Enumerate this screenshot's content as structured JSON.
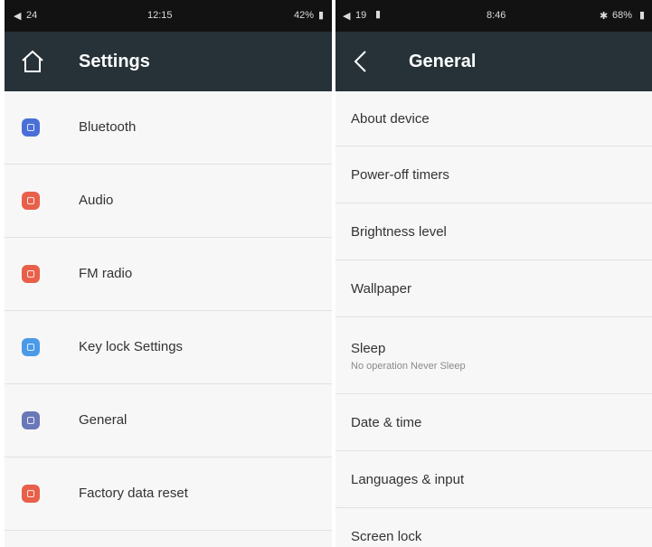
{
  "left": {
    "status": {
      "volume": "24",
      "time": "12:15",
      "battery": "42%"
    },
    "header": {
      "title": "Settings"
    },
    "items": [
      {
        "label": "Bluetooth",
        "icon": "bluetooth-icon",
        "color": "#4a6fd8"
      },
      {
        "label": "Audio",
        "icon": "audio-icon",
        "color": "#e8604a"
      },
      {
        "label": "FM radio",
        "icon": "radio-icon",
        "color": "#e8604a"
      },
      {
        "label": "Key lock Settings",
        "icon": "lock-icon",
        "color": "#4a9ae8"
      },
      {
        "label": "General",
        "icon": "general-icon",
        "color": "#6a78b8"
      },
      {
        "label": "Factory data reset",
        "icon": "reset-icon",
        "color": "#e8604a"
      }
    ]
  },
  "right": {
    "status": {
      "volume": "19",
      "time": "8:46",
      "battery": "68%"
    },
    "header": {
      "title": "General"
    },
    "items": [
      {
        "label": "About device"
      },
      {
        "label": "Power-off timers"
      },
      {
        "label": "Brightness level"
      },
      {
        "label": "Wallpaper"
      },
      {
        "label": "Sleep",
        "sub": "No operation Never Sleep"
      },
      {
        "label": "Date & time"
      },
      {
        "label": "Languages & input"
      },
      {
        "label": "Screen lock"
      }
    ]
  }
}
